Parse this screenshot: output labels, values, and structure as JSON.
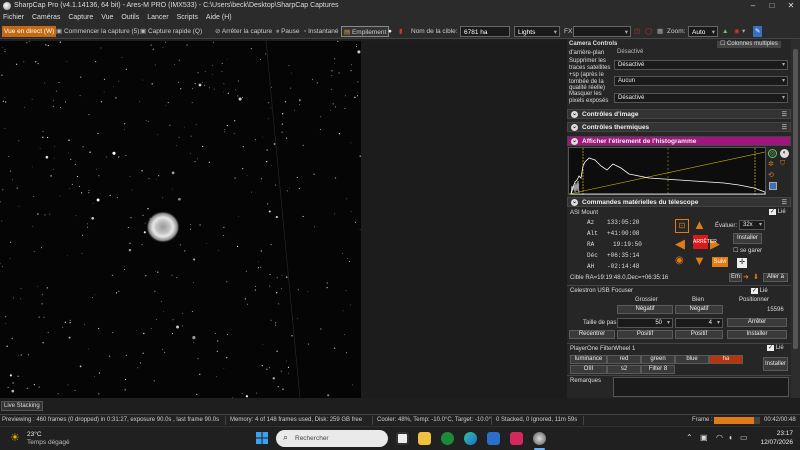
{
  "window": {
    "title": "SharpCap Pro (v4.1.14136, 64 bit) - Ares-M PRO (IMX533) - C:\\Users\\beck\\Desktop\\SharpCap Captures"
  },
  "menu": [
    "Fichier",
    "Caméras",
    "Capture",
    "Vue",
    "Outils",
    "Lancer",
    "Scripts",
    "Aide (H)"
  ],
  "toolbar": {
    "live_view": "Vue en direct (W)",
    "start_capture": "Commencer la capture (5)",
    "quick_capture": "Capture rapide (Q)",
    "stop_capture": "Arrêter la capture",
    "pause": "Pause",
    "snapshot": "Instantané",
    "stacking": "Empilement",
    "target_label": "Nom de la cible:",
    "target_value": "6781 ha",
    "frame_type": "Lights",
    "fx_label": "FX",
    "zoom_label": "Zoom:",
    "zoom_value": "Auto"
  },
  "panel": {
    "camera_controls_label": "Camera Controls",
    "multi_columns": "Colonnes multiples",
    "bg_label": "d'arrière-plan",
    "bg_value": "Désactivé",
    "sat_label": "Supprimer les traces satellites",
    "sat_value": "Désactivé",
    "qual_label": "+sp (après le tombée de la qualité réelle)",
    "qual_value": "Aucun",
    "mask_label": "Masquer les pixels exposés",
    "mask_value": "Désactivé",
    "image_controls": "Contrôles d'image",
    "thermal_controls": "Contrôles thermiques",
    "histogram": "Afficher l'étirement de l'histogramme",
    "telescope": "Commandes matérielles du télescope",
    "mount_name": "ASI Mount",
    "tied_label": "Lié",
    "az_label": "Az",
    "az_value": "133:05:20",
    "alt_label": "Alt",
    "alt_value": "+41:00:08",
    "ra_label": "RA",
    "ra_value": "19:19:50",
    "dec_label": "Déc",
    "dec_value": "+06:35:14",
    "ah_label": "AH",
    "ah_value": "-02:14:48",
    "stop_btn": "ARRÊTER",
    "follow_btn": "Suivi",
    "speed_label": "Évaluer:",
    "speed_value": "32x",
    "install_btn": "Installer",
    "no_move": "se garer",
    "target_coords": "Cible   RA=19:19:48.0,Dec=+06:35:16",
    "goto_btn": "Em",
    "go_btn": "Aller à",
    "focuser_name": "Celestron USB Focuser",
    "coarse_label": "Grossier",
    "fine_label": "Bien",
    "position_label": "Positionner",
    "negative_label": "Négatif",
    "position_value": "15596",
    "step_label": "Taille de pas",
    "coarse_step": "50",
    "fine_step": "4",
    "stop_focus": "Arrêter",
    "recenter_label": "Recentrer",
    "positive_label": "Positif",
    "install_focus": "Installer",
    "wheel_name": "PlayerOne FilterWheel 1",
    "filters_row1": [
      "luminance",
      "red",
      "green",
      "blue",
      "ha"
    ],
    "filters_row2": [
      "OIII",
      "s2",
      "Filter 8"
    ],
    "active_filter": "ha",
    "remarks_label": "Remarques"
  },
  "live_stacking_tab": "Live Stacking",
  "status": {
    "previewing": "Previewing : 460 frames (0 dropped) in 0:31:27, exposure 90.0s , last frame 90.0s",
    "memory": "Memory: 4 of 148 frames used, Disk: 259 GB free",
    "cooler": "Cooler: 48%, Temp: -10.0°C, Target: -10.0°",
    "stacked": "0 Stacked, 0 Ignored, 11m 59s",
    "frame_label": "Frame :",
    "frame_time": "00:42/00:48",
    "frame_progress": 0.88
  },
  "taskbar": {
    "temp": "23°C",
    "weather": "Temps dégagé",
    "search_placeholder": "Rechercher",
    "time": "23:17",
    "date": "12/07/2026"
  },
  "colors": {
    "accent_orange": "#e07b16",
    "histogram_magenta": "#a2157e",
    "dark_bg": "#1e1e1e"
  }
}
